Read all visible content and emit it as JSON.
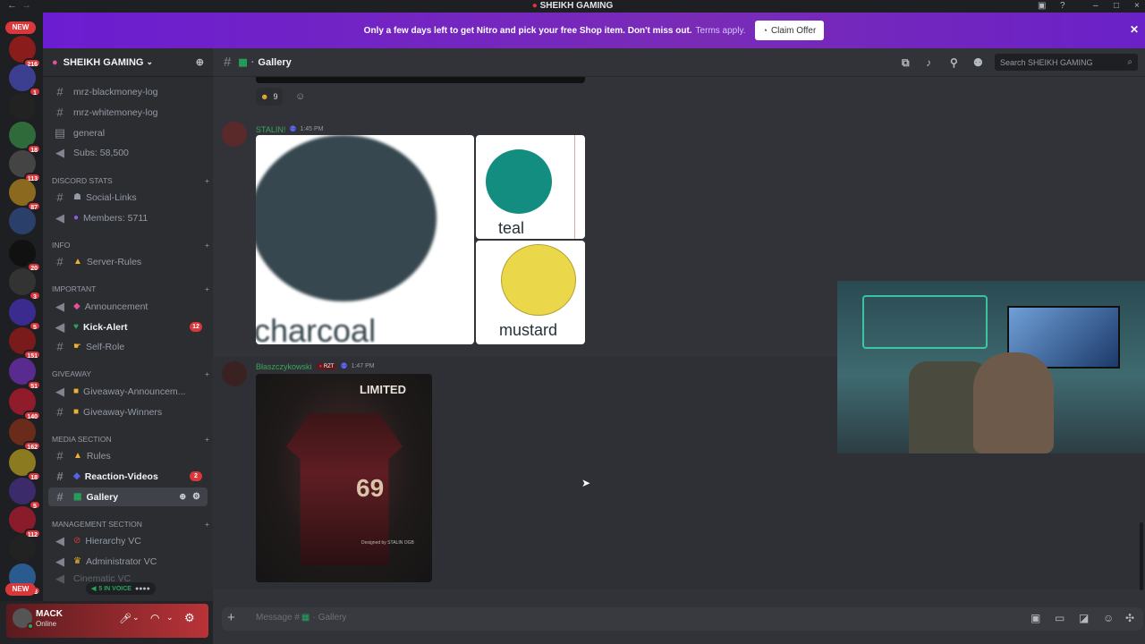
{
  "window": {
    "title": "SHEIKH GAMING"
  },
  "banner": {
    "text": "Only a few days left to get Nitro and pick your free Shop item. Don't miss out.",
    "link": "Terms apply.",
    "button": "Claim Offer"
  },
  "server": {
    "name": "SHEIKH GAMING"
  },
  "rail": {
    "new_label": "NEW",
    "badges": [
      "216",
      "1",
      "18",
      "113",
      "87",
      "20",
      "3",
      "5",
      "151",
      "51",
      "140",
      "162",
      "18",
      "5",
      "112",
      "573"
    ]
  },
  "channels": {
    "top": [
      {
        "name": "mrz-blackmoney-log"
      },
      {
        "name": "mrz-whitemoney-log"
      },
      {
        "name": "general"
      },
      {
        "name": "Subs: 58,500"
      }
    ],
    "discord_stats": {
      "label": "DISCORD STATS",
      "items": [
        {
          "name": "Social-Links"
        },
        {
          "name": "Members: 5711"
        }
      ]
    },
    "info": {
      "label": "INFO",
      "items": [
        {
          "name": "Server-Rules"
        }
      ]
    },
    "important": {
      "label": "IMPORTANT",
      "items": [
        {
          "name": "Announcement"
        },
        {
          "name": "Kick-Alert",
          "count": "12"
        },
        {
          "name": "Self-Role"
        }
      ]
    },
    "giveaway": {
      "label": "GIVEAWAY",
      "items": [
        {
          "name": "Giveaway-Announcem..."
        },
        {
          "name": "Giveaway-Winners"
        }
      ]
    },
    "media": {
      "label": "MEDIA SECTION",
      "items": [
        {
          "name": "Rules"
        },
        {
          "name": "Reaction-Videos",
          "count": "2"
        },
        {
          "name": "Gallery"
        }
      ]
    },
    "management": {
      "label": "MANAGEMENT SECTION",
      "items": [
        {
          "name": "Hierarchy VC"
        },
        {
          "name": "Administrator VC"
        },
        {
          "name": "Cinematic VC"
        }
      ]
    },
    "in_voice": "5 IN VOICE"
  },
  "user": {
    "name": "MACK",
    "status": "Online"
  },
  "channel_header": {
    "name": "Gallery",
    "search_placeholder": "Search SHEIKH GAMING"
  },
  "messages": [
    {
      "reaction_count": "9"
    },
    {
      "author": "STALIN!",
      "time": "1:45 PM",
      "images": {
        "charcoal": "charcoal",
        "teal": "teal",
        "mustard": "mustard"
      }
    },
    {
      "author": "Błaszczykowski",
      "tag": "RZT",
      "time": "1:47 PM",
      "image": {
        "headline": "LIMITED",
        "number": "69",
        "footer": "Designed by STALIN OGB"
      }
    }
  ],
  "composer": {
    "placeholder": "Message #",
    "channel": "Gallery"
  },
  "colors": {
    "accent_green": "#3ba55c",
    "badge_red": "#da373c",
    "nitro_purple": "#6b1dd1",
    "teal": "#138d80",
    "mustard": "#ead74a",
    "charcoal": "#37474f"
  }
}
